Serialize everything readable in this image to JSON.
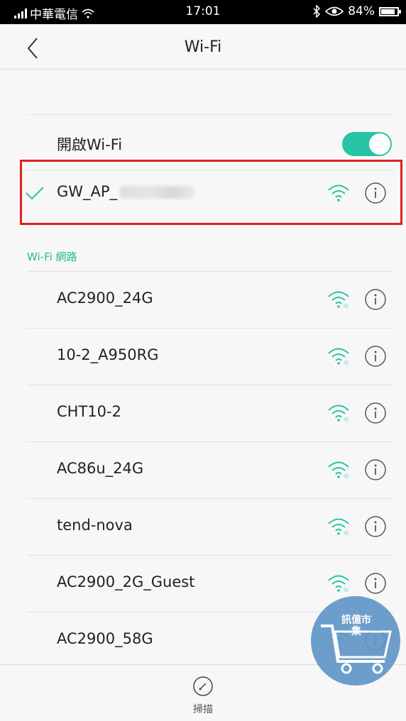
{
  "status_bar": {
    "carrier": "中華電信",
    "time": "17:01",
    "battery": "84%"
  },
  "header": {
    "title": "Wi-Fi"
  },
  "wifi_toggle": {
    "label": "開啟Wi-Fi",
    "enabled": true
  },
  "connected_network": {
    "ssid_prefix": "GW_AP_"
  },
  "section": {
    "label": "Wi-Fi 網路"
  },
  "networks": [
    {
      "ssid": "AC2900_24G"
    },
    {
      "ssid": "10-2_A950RG"
    },
    {
      "ssid": "CHT10-2"
    },
    {
      "ssid": "AC86u_24G"
    },
    {
      "ssid": "tend-nova"
    },
    {
      "ssid": "AC2900_2G_Guest"
    },
    {
      "ssid": "AC2900_58G"
    }
  ],
  "bottom_bar": {
    "scan_label": "掃描"
  },
  "watermark": {
    "text": "訊億市集"
  },
  "colors": {
    "accent": "#26c4a5",
    "highlight_border": "#e02020"
  }
}
